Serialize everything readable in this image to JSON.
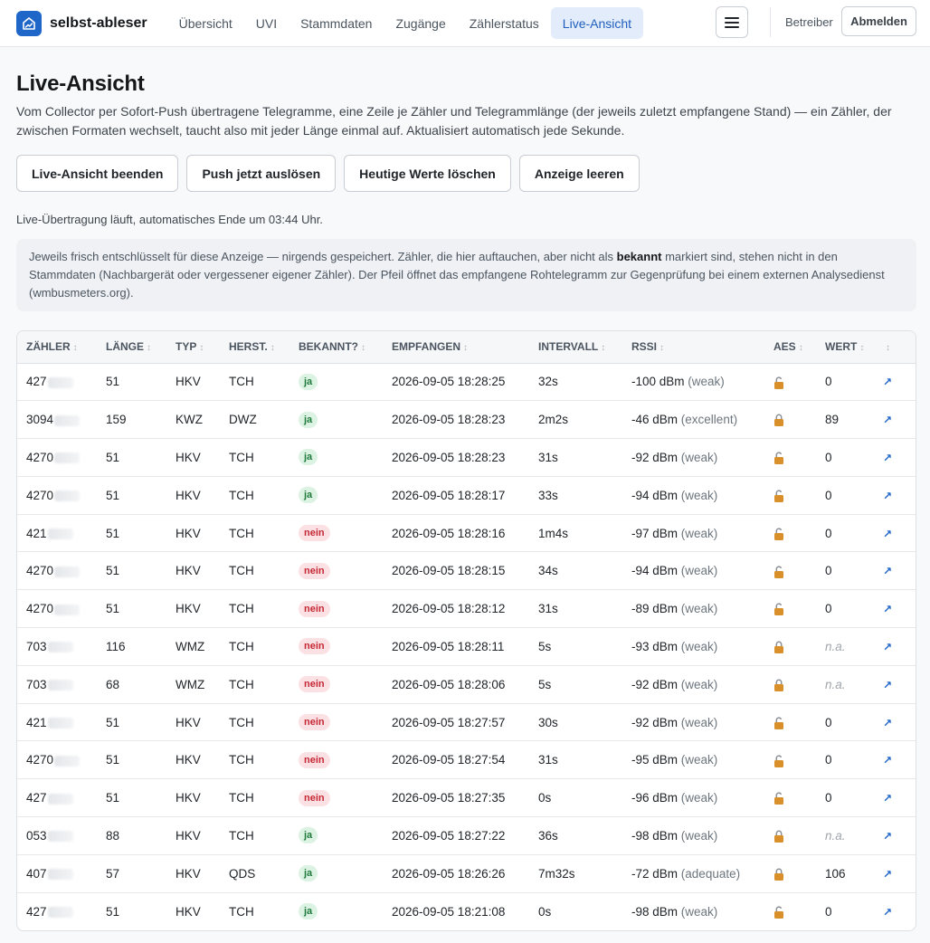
{
  "brand": {
    "name": "selbst-ableser",
    "icon": "chart-house-icon"
  },
  "nav": {
    "items": [
      {
        "label": "Übersicht",
        "active": false
      },
      {
        "label": "UVI",
        "active": false
      },
      {
        "label": "Stammdaten",
        "active": false
      },
      {
        "label": "Zugänge",
        "active": false
      },
      {
        "label": "Zählerstatus",
        "active": false
      },
      {
        "label": "Live-Ansicht",
        "active": true
      }
    ],
    "menu_icon": "hamburger-icon",
    "role": "Betreiber",
    "logout": "Abmelden"
  },
  "page": {
    "title": "Live-Ansicht",
    "lead": "Vom Collector per Sofort-Push übertragene Telegramme, eine Zeile je Zähler und Telegrammlänge (der jeweils zuletzt empfangene Stand) — ein Zähler, der zwischen Formaten wechselt, taucht also mit jeder Länge einmal auf. Aktualisiert automatisch jede Sekunde.",
    "buttons": [
      "Live-Ansicht beenden",
      "Push jetzt auslösen",
      "Heutige Werte löschen",
      "Anzeige leeren"
    ],
    "status": "Live-Übertragung läuft, automatisches Ende um 03:44 Uhr.",
    "info_before": "Jeweils frisch entschlüsselt für diese Anzeige — nirgends gespeichert. Zähler, die hier auftauchen, aber nicht als ",
    "info_bold": "bekannt",
    "info_after": " markiert sind, stehen nicht in den Stammdaten (Nachbargerät oder vergessener eigener Zähler). Der Pfeil öffnet das empfangene Rohtelegramm zur Gegenprüfung bei einem externen Analysedienst (wmbusmeters.org)."
  },
  "table": {
    "columns": [
      "ZÄHLER",
      "LÄNGE",
      "TYP",
      "HERST.",
      "BEKANNT?",
      "EMPFANGEN",
      "INTERVALL",
      "RSSI",
      "AES",
      "WERT",
      ""
    ],
    "sort_icon": "sort-arrows-icon",
    "rows": [
      {
        "meter": "427",
        "len": "51",
        "typ": "HKV",
        "herst": "TCH",
        "known": "ja",
        "received": "2026-09-05 18:28:25",
        "interval": "32s",
        "rssi": "-100 dBm",
        "quality": "(weak)",
        "aes": "unlocked",
        "value": "0"
      },
      {
        "meter": "3094",
        "len": "159",
        "typ": "KWZ",
        "herst": "DWZ",
        "known": "ja",
        "received": "2026-09-05 18:28:23",
        "interval": "2m2s",
        "rssi": "-46 dBm",
        "quality": "(excellent)",
        "aes": "locked",
        "value": "89"
      },
      {
        "meter": "4270",
        "len": "51",
        "typ": "HKV",
        "herst": "TCH",
        "known": "ja",
        "received": "2026-09-05 18:28:23",
        "interval": "31s",
        "rssi": "-92 dBm",
        "quality": "(weak)",
        "aes": "unlocked",
        "value": "0"
      },
      {
        "meter": "4270",
        "len": "51",
        "typ": "HKV",
        "herst": "TCH",
        "known": "ja",
        "received": "2026-09-05 18:28:17",
        "interval": "33s",
        "rssi": "-94 dBm",
        "quality": "(weak)",
        "aes": "unlocked",
        "value": "0"
      },
      {
        "meter": "421",
        "len": "51",
        "typ": "HKV",
        "herst": "TCH",
        "known": "nein",
        "received": "2026-09-05 18:28:16",
        "interval": "1m4s",
        "rssi": "-97 dBm",
        "quality": "(weak)",
        "aes": "unlocked",
        "value": "0"
      },
      {
        "meter": "4270",
        "len": "51",
        "typ": "HKV",
        "herst": "TCH",
        "known": "nein",
        "received": "2026-09-05 18:28:15",
        "interval": "34s",
        "rssi": "-94 dBm",
        "quality": "(weak)",
        "aes": "unlocked",
        "value": "0"
      },
      {
        "meter": "4270",
        "len": "51",
        "typ": "HKV",
        "herst": "TCH",
        "known": "nein",
        "received": "2026-09-05 18:28:12",
        "interval": "31s",
        "rssi": "-89 dBm",
        "quality": "(weak)",
        "aes": "unlocked",
        "value": "0"
      },
      {
        "meter": "703",
        "len": "116",
        "typ": "WMZ",
        "herst": "TCH",
        "known": "nein",
        "received": "2026-09-05 18:28:11",
        "interval": "5s",
        "rssi": "-93 dBm",
        "quality": "(weak)",
        "aes": "locked",
        "value": "n.a."
      },
      {
        "meter": "703",
        "len": "68",
        "typ": "WMZ",
        "herst": "TCH",
        "known": "nein",
        "received": "2026-09-05 18:28:06",
        "interval": "5s",
        "rssi": "-92 dBm",
        "quality": "(weak)",
        "aes": "locked",
        "value": "n.a."
      },
      {
        "meter": "421",
        "len": "51",
        "typ": "HKV",
        "herst": "TCH",
        "known": "nein",
        "received": "2026-09-05 18:27:57",
        "interval": "30s",
        "rssi": "-92 dBm",
        "quality": "(weak)",
        "aes": "unlocked",
        "value": "0"
      },
      {
        "meter": "4270",
        "len": "51",
        "typ": "HKV",
        "herst": "TCH",
        "known": "nein",
        "received": "2026-09-05 18:27:54",
        "interval": "31s",
        "rssi": "-95 dBm",
        "quality": "(weak)",
        "aes": "unlocked",
        "value": "0"
      },
      {
        "meter": "427",
        "len": "51",
        "typ": "HKV",
        "herst": "TCH",
        "known": "nein",
        "received": "2026-09-05 18:27:35",
        "interval": "0s",
        "rssi": "-96 dBm",
        "quality": "(weak)",
        "aes": "unlocked",
        "value": "0"
      },
      {
        "meter": "053",
        "len": "88",
        "typ": "HKV",
        "herst": "TCH",
        "known": "ja",
        "received": "2026-09-05 18:27:22",
        "interval": "36s",
        "rssi": "-98 dBm",
        "quality": "(weak)",
        "aes": "locked",
        "value": "n.a."
      },
      {
        "meter": "407",
        "len": "57",
        "typ": "HKV",
        "herst": "QDS",
        "known": "ja",
        "received": "2026-09-05 18:26:26",
        "interval": "7m32s",
        "rssi": "-72 dBm",
        "quality": "(adequate)",
        "aes": "locked",
        "value": "106"
      },
      {
        "meter": "427",
        "len": "51",
        "typ": "HKV",
        "herst": "TCH",
        "known": "ja",
        "received": "2026-09-05 18:21:08",
        "interval": "0s",
        "rssi": "-98 dBm",
        "quality": "(weak)",
        "aes": "unlocked",
        "value": "0"
      }
    ],
    "arrow_icon": "external-arrow-icon"
  }
}
